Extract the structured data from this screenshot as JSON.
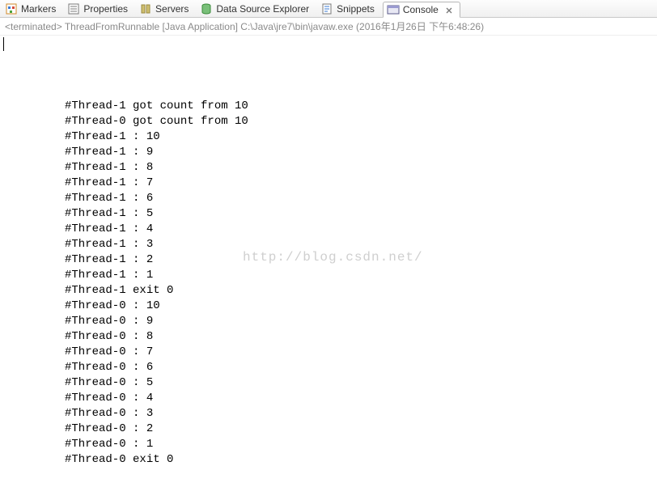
{
  "tabs": [
    {
      "label": "Markers"
    },
    {
      "label": "Properties"
    },
    {
      "label": "Servers"
    },
    {
      "label": "Data Source Explorer"
    },
    {
      "label": "Snippets"
    },
    {
      "label": "Console"
    }
  ],
  "status": "<terminated> ThreadFromRunnable [Java Application] C:\\Java\\jre7\\bin\\javaw.exe (2016年1月26日 下午6:48:26)",
  "watermark": "http://blog.csdn.net/",
  "output": [
    "#Thread-1 got count from 10",
    "#Thread-0 got count from 10",
    "#Thread-1 : 10",
    "#Thread-1 : 9",
    "#Thread-1 : 8",
    "#Thread-1 : 7",
    "#Thread-1 : 6",
    "#Thread-1 : 5",
    "#Thread-1 : 4",
    "#Thread-1 : 3",
    "#Thread-1 : 2",
    "#Thread-1 : 1",
    "#Thread-1 exit 0",
    "#Thread-0 : 10",
    "#Thread-0 : 9",
    "#Thread-0 : 8",
    "#Thread-0 : 7",
    "#Thread-0 : 6",
    "#Thread-0 : 5",
    "#Thread-0 : 4",
    "#Thread-0 : 3",
    "#Thread-0 : 2",
    "#Thread-0 : 1",
    "#Thread-0 exit 0"
  ]
}
